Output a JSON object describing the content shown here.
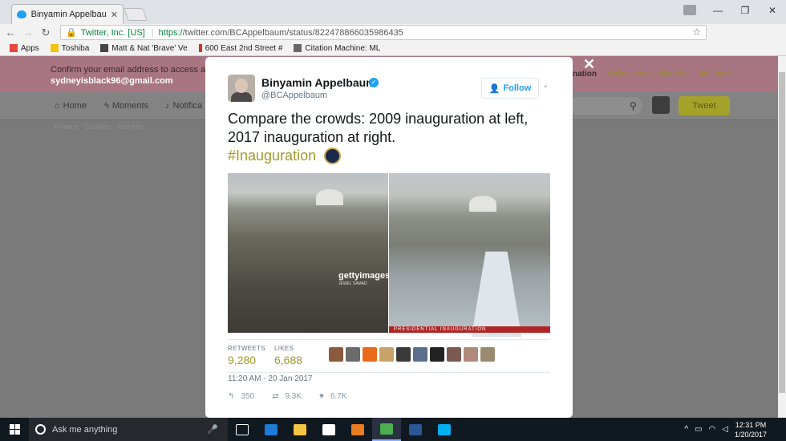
{
  "browser": {
    "tab_title": "Binyamin Appelbaum on",
    "tab_close": "✕",
    "win_min": "—",
    "win_restore": "❐",
    "win_close": "✕",
    "url_secure_label": "Twitter, Inc. [US]",
    "url_protocol": "https://",
    "url_host_path": "twitter.com/BCAppelbaum/status/822478866035986435",
    "bookmarks": [
      {
        "label": "Apps",
        "color": "#e8453c"
      },
      {
        "label": "Toshiba",
        "color": "#f4c20d"
      },
      {
        "label": "Matt & Nat 'Brave' Ve",
        "color": "#444444"
      },
      {
        "label": "600 East 2nd Street #",
        "color": "#d93025"
      },
      {
        "label": "Citation Machine: ML",
        "color": "#666666"
      }
    ]
  },
  "twitter_bg": {
    "confirm_line": "Confirm your email address to access all o",
    "confirm_email": "sydneyisblack96@gmail.com",
    "confirm_button": "nation",
    "confirm_links": "Update email address · Learn more",
    "nav_home": "Home",
    "nav_moments": "Moments",
    "nav_notifications": "Notifica",
    "tweet_button": "Tweet",
    "footer_links": [
      "Privacy",
      "Cookies",
      "Ads info"
    ]
  },
  "tweet": {
    "author_name": "Binyamin Appelbaum",
    "author_handle": "@BCAppelbaum",
    "follow_label": "Follow",
    "text": "Compare the crowds: 2009 inauguration at left, 2017 inauguration at right.",
    "hashtag": "#Inauguration",
    "photo_watermark": "gettyimages",
    "photo_credit": "JEWEL SAMAD",
    "photo_banner": "PRESIDENTIAL INAUGURATION",
    "retweets_label": "RETWEETS",
    "retweets_count": "9,280",
    "likes_label": "LIKES",
    "likes_count": "6,688",
    "timestamp": "11:20 AM - 20 Jan 2017",
    "replies": "350",
    "retweets_short": "9.3K",
    "likes_short": "6.7K",
    "liker_colors": [
      "#8a5a3c",
      "#6b6b6b",
      "#e86a1a",
      "#c9a26a",
      "#3a3a3a",
      "#5b6e8c",
      "#222222",
      "#7a5a50",
      "#b08a7a",
      "#9a8a70"
    ]
  },
  "taskbar": {
    "search_placeholder": "Ask me anything",
    "time": "12:31 PM",
    "date": "1/20/2017",
    "apps": [
      {
        "name": "task-view-icon",
        "color": "#ffffff"
      },
      {
        "name": "edge-icon",
        "color": "#1e7bd7"
      },
      {
        "name": "file-explorer-icon",
        "color": "#f4c542"
      },
      {
        "name": "store-icon",
        "color": "#ffffff"
      },
      {
        "name": "media-player-icon",
        "color": "#e87e22"
      },
      {
        "name": "chrome-icon",
        "color": "#4caf50"
      },
      {
        "name": "word-icon",
        "color": "#2b5797"
      },
      {
        "name": "skype-icon",
        "color": "#00aff0"
      }
    ]
  },
  "colors": {
    "twitter_blue": "#1da1f2",
    "accent_olive": "#a09a2a"
  }
}
